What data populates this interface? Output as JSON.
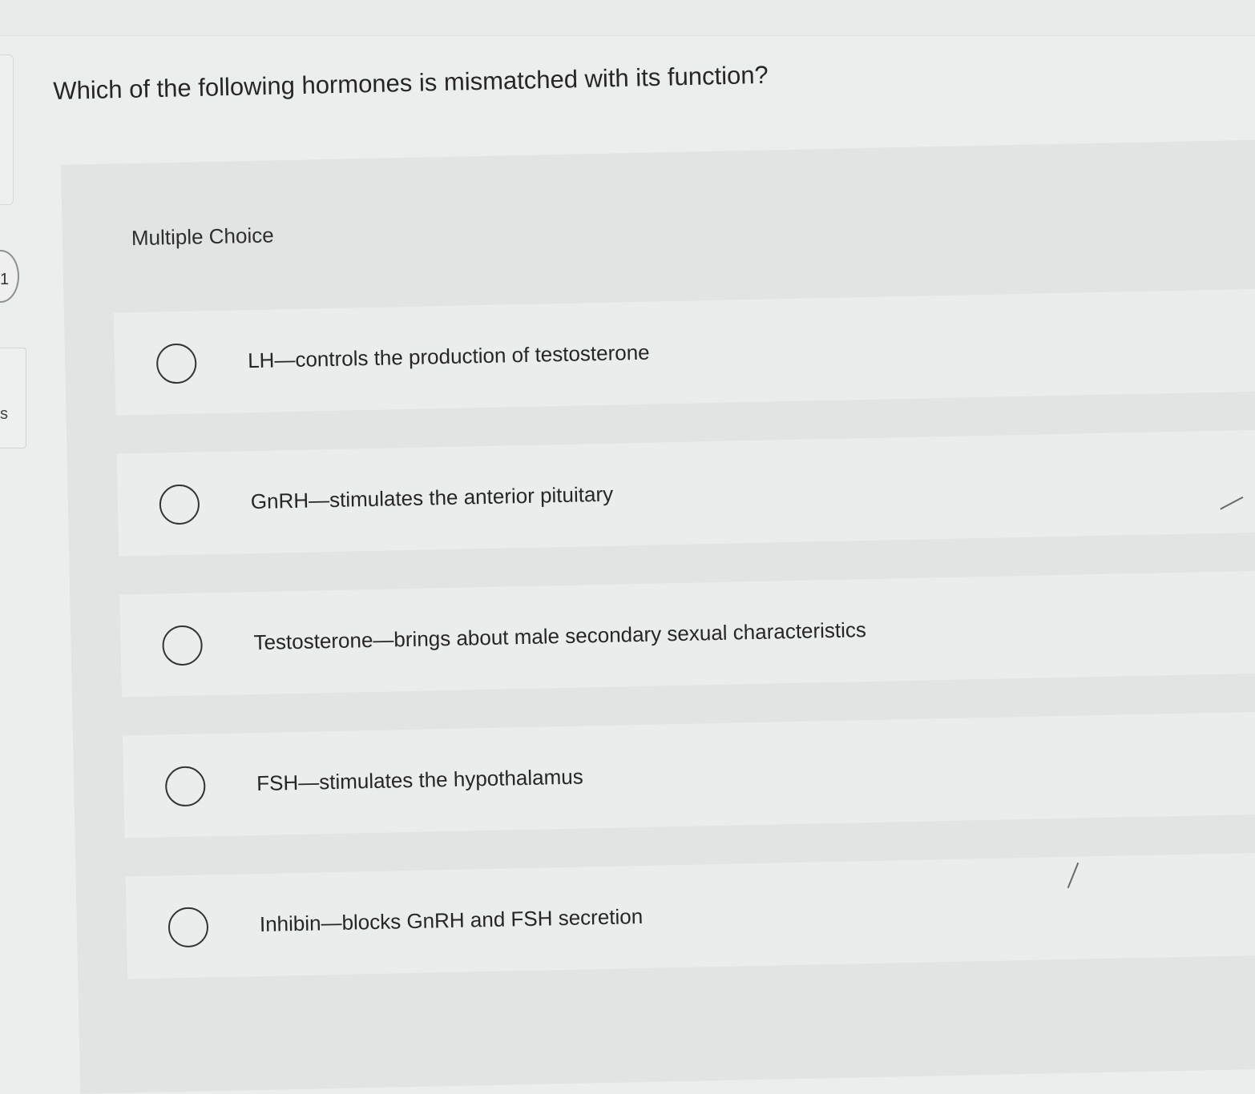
{
  "question": {
    "text": "Which of the following hormones is mismatched with its function?"
  },
  "answer_area": {
    "type_label": "Multiple Choice",
    "options": [
      {
        "label": "LH—controls the production of testosterone",
        "selected": false
      },
      {
        "label": "GnRH—stimulates the anterior pituitary",
        "selected": false
      },
      {
        "label": "Testosterone—brings about male secondary sexual characteristics",
        "selected": false
      },
      {
        "label": "FSH—stimulates the hypothalamus",
        "selected": false
      },
      {
        "label": "Inhibin—blocks GnRH and FSH secretion",
        "selected": false
      }
    ]
  },
  "left_rail": {
    "question_number_fragment": "1",
    "tab_fragment": "s"
  },
  "colors": {
    "background": "#eceded",
    "panel": "#e2e3e3",
    "option_row": "#ebecec",
    "text": "#262626",
    "radio_border": "#333333"
  }
}
